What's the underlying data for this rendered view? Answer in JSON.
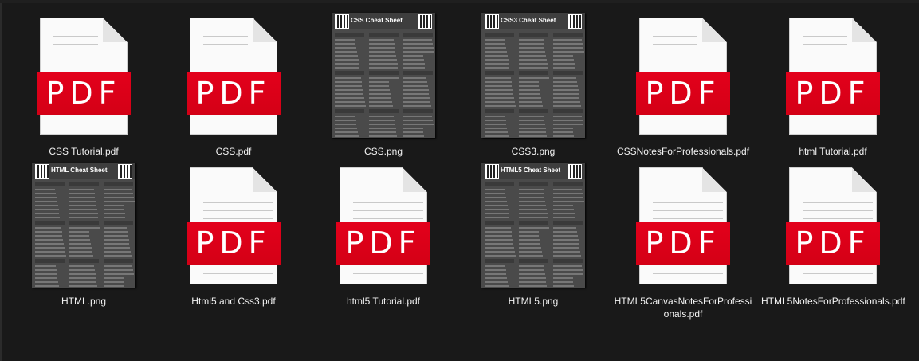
{
  "items": [
    {
      "name": "CSS Tutorial.pdf",
      "type": "pdf"
    },
    {
      "name": "CSS.pdf",
      "type": "pdf"
    },
    {
      "name": "CSS.png",
      "type": "png",
      "thumb_title": "CSS Cheat Sheet"
    },
    {
      "name": "CSS3.png",
      "type": "png",
      "thumb_title": "CSS3 Cheat Sheet"
    },
    {
      "name": "CSSNotesForProfessionals.pdf",
      "type": "pdf"
    },
    {
      "name": "html Tutorial.pdf",
      "type": "pdf"
    },
    {
      "name": "HTML.png",
      "type": "png",
      "thumb_title": "HTML Cheat Sheet"
    },
    {
      "name": "Html5 and Css3.pdf",
      "type": "pdf"
    },
    {
      "name": "html5 Tutorial.pdf",
      "type": "pdf"
    },
    {
      "name": "HTML5.png",
      "type": "png",
      "thumb_title": "HTML5 Cheat Sheet"
    },
    {
      "name": "HTML5CanvasNotesForProfessionals.pdf",
      "type": "pdf"
    },
    {
      "name": "HTML5NotesForProfessionals.pdf",
      "type": "pdf"
    }
  ],
  "pdf_badge": "PDF",
  "colors": {
    "background": "#191919",
    "pdf_red": "#e3001b",
    "text": "#f2f2f2"
  }
}
